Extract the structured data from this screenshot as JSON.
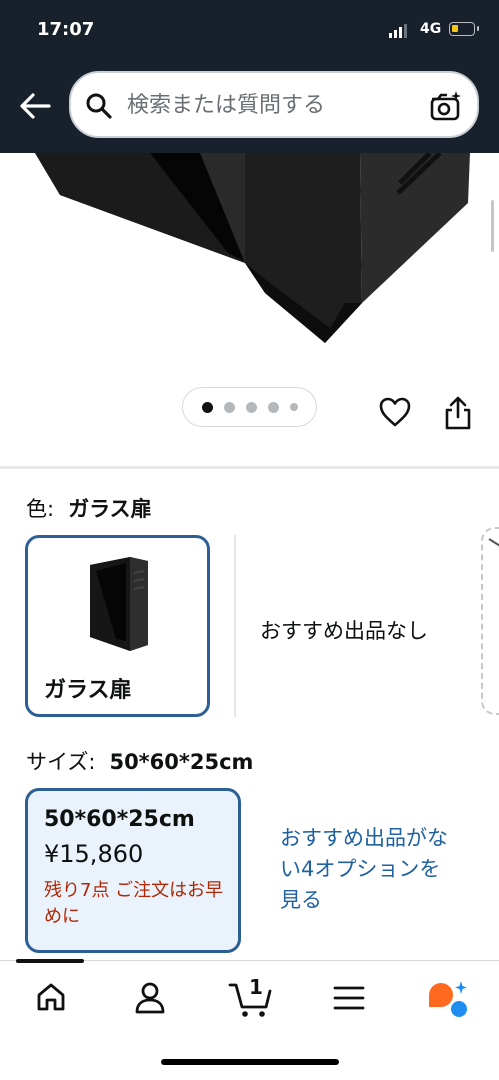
{
  "status_bar": {
    "time": "17:07",
    "network": "4G"
  },
  "search": {
    "placeholder": "検索または質問する",
    "value": ""
  },
  "carousel": {
    "image_count": 5,
    "active_index": 0
  },
  "color": {
    "label": "色:",
    "selected": "ガラス扉",
    "option_label": "ガラス扉",
    "no_recommendation": "おすすめ出品なし"
  },
  "size": {
    "label": "サイズ:",
    "selected": "50*60*25cm",
    "option_size": "50*60*25cm",
    "price": "¥15,860",
    "stock_note": "残り7点 ご注文はお早めに",
    "more_options_link": "おすすめ出品がない4オプションを見る"
  },
  "bottom_nav": {
    "items": [
      "home-icon",
      "account-icon",
      "cart-icon",
      "menu-icon",
      "rufus-icon"
    ],
    "cart_count": "1"
  },
  "colors": {
    "header_bg": "#17202b",
    "selected_border": "#2c5f94",
    "link": "#2162a1",
    "stock_warning": "#b12704"
  }
}
